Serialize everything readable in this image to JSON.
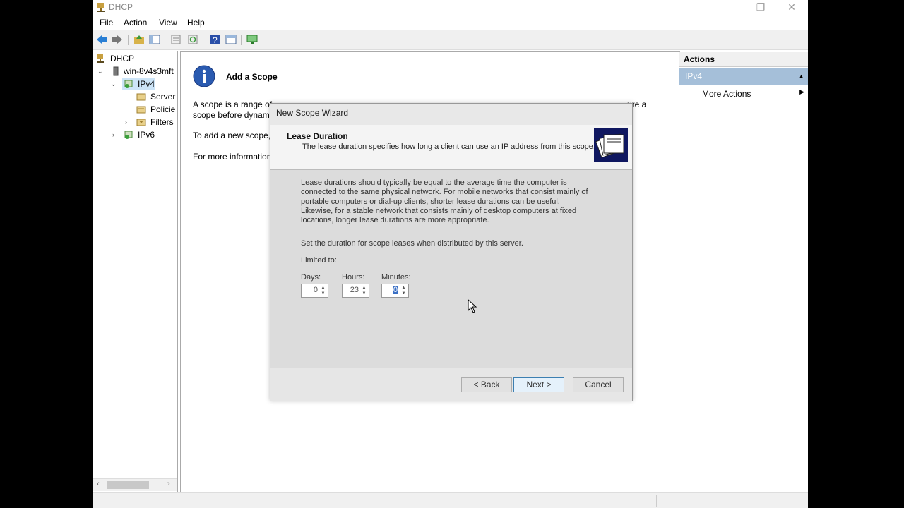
{
  "window": {
    "title": "DHCP"
  },
  "menu": {
    "file": "File",
    "action": "Action",
    "view": "View",
    "help": "Help"
  },
  "tree": {
    "root": "DHCP",
    "server": "win-8v4s3mft",
    "ipv4": "IPv4",
    "server_options": "Server",
    "policies": "Policie",
    "filters": "Filters",
    "ipv6": "IPv6"
  },
  "main": {
    "heading": "Add a Scope",
    "para1_line1": "A scope is a range of",
    "para1_right": "ure a",
    "para1_line2": "scope before dynami",
    "para2": "To add a new scope,",
    "para3": "For more information"
  },
  "actions": {
    "title": "Actions",
    "section": "IPv4",
    "more": "More Actions"
  },
  "wizard": {
    "title": "New Scope Wizard",
    "header_title": "Lease Duration",
    "header_sub": "The lease duration specifies how long a client can use an IP address from this scope.",
    "desc_l1": "Lease durations should typically be equal to the average time the computer is",
    "desc_l2": "connected to the same physical network. For mobile networks that consist mainly of",
    "desc_l3": "portable computers or dial-up clients, shorter lease durations can be useful.",
    "desc_l4": "Likewise, for a stable network that consists mainly of desktop computers at fixed",
    "desc_l5": "locations, longer lease durations are more appropriate.",
    "set_text": "Set the duration for scope leases when distributed by this server.",
    "limited": "Limited to:",
    "days_label": "Days:",
    "days_value": "0",
    "hours_label": "Hours:",
    "hours_value": "23",
    "minutes_label": "Minutes:",
    "minutes_value": "0",
    "back": "< Back",
    "next": "Next >",
    "cancel": "Cancel"
  }
}
